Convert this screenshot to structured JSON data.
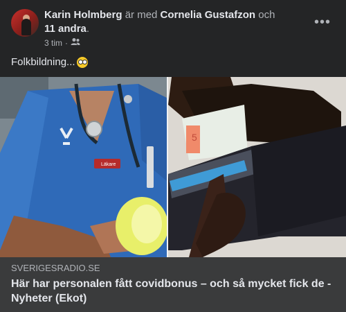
{
  "post": {
    "author": "Karin Holmberg",
    "with_text": "är med",
    "tagged": "Cornelia Gustafzon",
    "and_text": "och",
    "others": "11 andra",
    "period": ".",
    "time": "3 tim",
    "separator": "·",
    "audience_icon": "friends-icon",
    "more_icon": "more-options-icon",
    "more_label": "•••",
    "text": "Folkbildning...",
    "emoji": "flushed-face-emoji"
  },
  "image": {
    "left_panel": "nurse-in-scrubs",
    "left_badge": "Läkare",
    "right_panel": "hand-taking-money-from-wallet"
  },
  "link": {
    "domain": "SVERIGESRADIO.SE",
    "title": "Här har personalen fått covidbonus – och så mycket fick de - Nyheter (Ekot)"
  }
}
